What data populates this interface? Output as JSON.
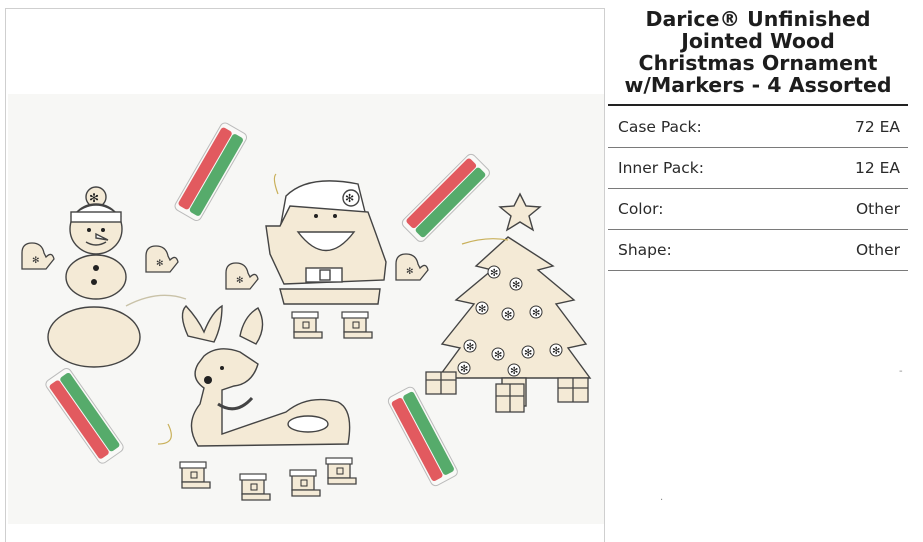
{
  "product": {
    "title_lines": [
      "Darice® Unfinished",
      "Jointed Wood",
      "Christmas Ornament",
      "w/Markers - 4 Assorted"
    ]
  },
  "specs": [
    {
      "label": "Case Pack:",
      "value": "72 EA"
    },
    {
      "label": "Inner Pack:",
      "value": "12 EA"
    },
    {
      "label": "Color:",
      "value": "Other"
    },
    {
      "label": "Shape:",
      "value": "Other"
    }
  ],
  "colors": {
    "marker_red": "#d8232a",
    "marker_green": "#1e8f3a",
    "wood": "#f4ead6",
    "outline": "#333333"
  }
}
